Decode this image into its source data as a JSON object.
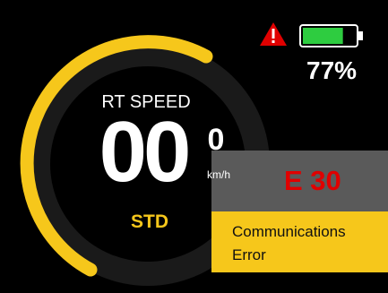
{
  "dashboard": {
    "title": "RT SPEED",
    "speed_main": "00",
    "speed_fraction": "0",
    "unit": "km/h",
    "mode": "STD"
  },
  "status": {
    "battery_percent": "77%",
    "battery_level": 0.77,
    "warning_icon": "warning-triangle-icon"
  },
  "error": {
    "code": "E 30",
    "message": "Communications\nError"
  },
  "colors": {
    "background": "#000000",
    "accent": "#f6c71b",
    "dial_dark": "#1f1f1f",
    "error_red": "#e00000",
    "error_band": "#5a5a5a",
    "battery_green": "#2ecc40"
  }
}
